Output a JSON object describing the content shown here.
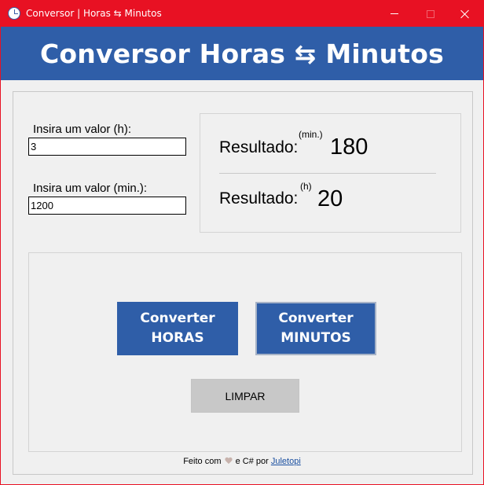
{
  "window": {
    "title": "Conversor | Horas ⇆ Minutos",
    "title_bar_color": "#e81123",
    "controls": {
      "minimize": "minimize-icon",
      "maximize": "maximize-icon",
      "close": "close-icon"
    }
  },
  "header": {
    "title": "Conversor Horas ⇆ Minutos",
    "background": "#2f5ea8"
  },
  "inputs": {
    "hours_label": "Insira um valor (h):",
    "hours_value": "3",
    "minutes_label": "Insira um valor (min.):",
    "minutes_value": "1200"
  },
  "results": {
    "minutes_label": "Resultado:",
    "minutes_unit": "(min.)",
    "minutes_value": "180",
    "hours_label": "Resultado:",
    "hours_unit": "(h)",
    "hours_value": "20"
  },
  "buttons": {
    "convert_hours_line1": "Converter",
    "convert_hours_line2": "HORAS",
    "convert_minutes_line1": "Converter",
    "convert_minutes_line2": "MINUTOS",
    "clear": "LIMPAR"
  },
  "footer": {
    "text_before": "Feito com",
    "text_middle": "e C# por",
    "link": "Juletopi"
  }
}
